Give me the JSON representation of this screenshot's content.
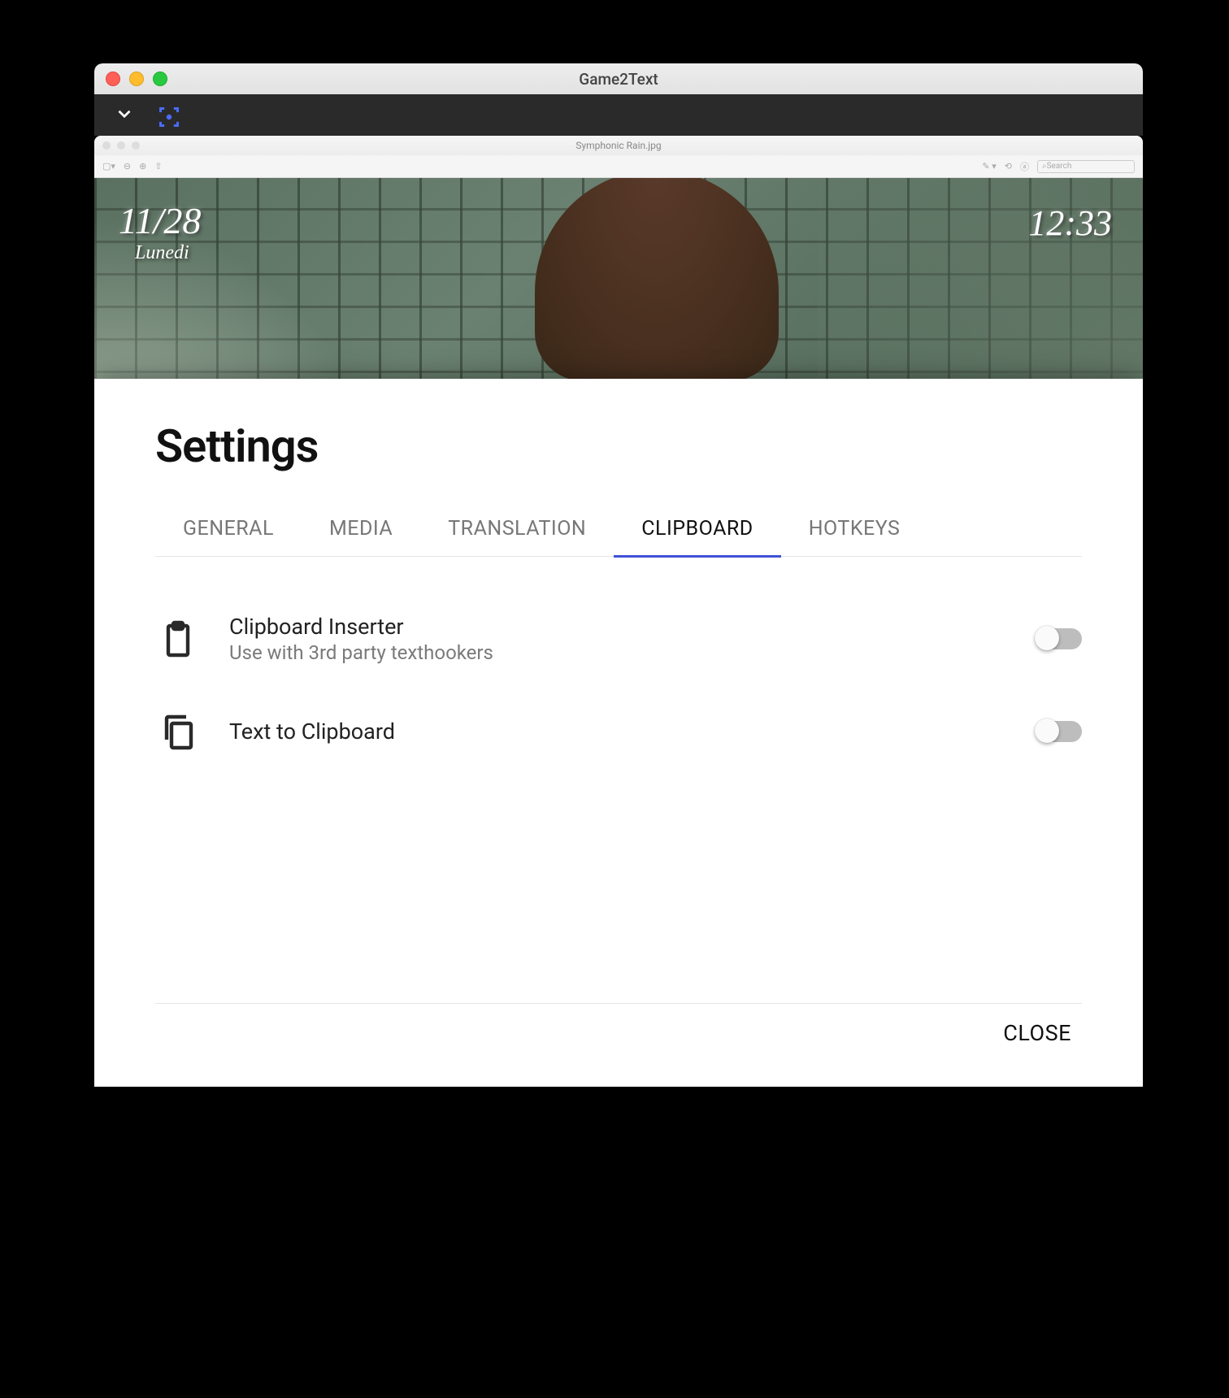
{
  "window": {
    "title": "Game2Text"
  },
  "innerWindow": {
    "filename": "Symphonic Rain.jpg",
    "search_placeholder": "Search"
  },
  "game": {
    "date": "11/28",
    "day": "Lunedi",
    "time": "12:33"
  },
  "modal": {
    "title": "Settings",
    "tabs": {
      "general": "GENERAL",
      "media": "MEDIA",
      "translation": "TRANSLATION",
      "clipboard": "CLIPBOARD",
      "hotkeys": "HOTKEYS"
    },
    "settings": {
      "clipboard_inserter": {
        "title": "Clipboard Inserter",
        "subtitle": "Use with 3rd party texthookers"
      },
      "text_to_clipboard": {
        "title": "Text to Clipboard"
      }
    },
    "close": "CLOSE"
  }
}
